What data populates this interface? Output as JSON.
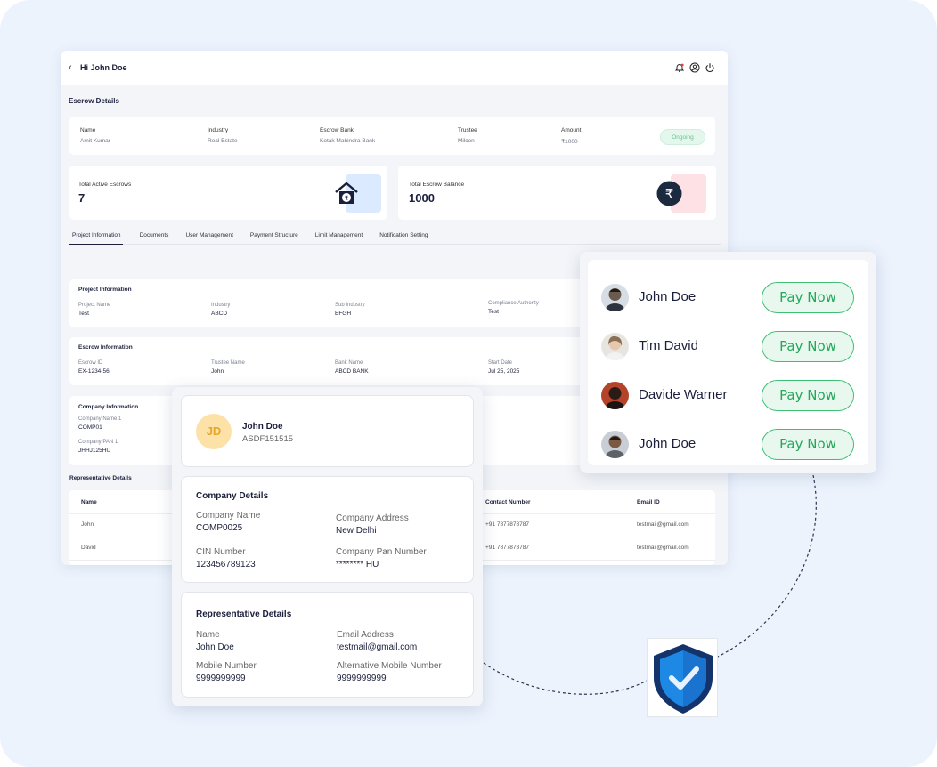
{
  "header": {
    "greeting": "Hi John Doe"
  },
  "escrow": {
    "title": "Escrow Details",
    "fields": [
      {
        "label": "Name",
        "value": "Amit Kumar"
      },
      {
        "label": "Industry",
        "value": "Real Estate"
      },
      {
        "label": "Escrow Bank",
        "value": "Kotak Mahindra Bank"
      },
      {
        "label": "Trustee",
        "value": "Milcon"
      },
      {
        "label": "Amount",
        "value": "₹1000"
      }
    ],
    "status": "Ongoing"
  },
  "stats": [
    {
      "label": "Total Active Escrows",
      "value": "7",
      "icon": "house-rupee-icon"
    },
    {
      "label": "Total Escrow Balance",
      "value": "1000",
      "icon": "rupee-icon"
    }
  ],
  "tabs": [
    "Project Information",
    "Documents",
    "User Management",
    "Payment Structure",
    "Limit Management",
    "Notification Setting"
  ],
  "project_info": {
    "title": "Project Information",
    "fields": [
      {
        "label": "Project Name",
        "value": "Test"
      },
      {
        "label": "Industry",
        "value": "ABCD"
      },
      {
        "label": "Sub Industry",
        "value": "EFGH"
      },
      {
        "label": "Compliance Authority",
        "value": "Test"
      }
    ]
  },
  "escrow_info": {
    "title": "Escrow Information",
    "fields": [
      {
        "label": "Escrow ID",
        "value": "EX-1234-56"
      },
      {
        "label": "Trustee Name",
        "value": "John"
      },
      {
        "label": "Bank Name",
        "value": "ABCD BANK"
      },
      {
        "label": "Start Date",
        "value": "Jul 25, 2025"
      }
    ]
  },
  "company_info": {
    "title": "Company Information",
    "fields": [
      {
        "label": "Company Name 1",
        "value": "COMP01"
      },
      {
        "label": "Company PAN 1",
        "value": "JHHJ125HU"
      }
    ]
  },
  "representatives": {
    "title": "Representative Details",
    "columns": [
      "Name",
      "Contact Number",
      "Email ID"
    ],
    "rows": [
      {
        "name": "John",
        "contact": "+91 7877878787",
        "email": "testmail@gmail.com"
      },
      {
        "name": "David",
        "contact": "+91 7877878787",
        "email": "testmail@gmail.com"
      }
    ]
  },
  "detail_popup": {
    "initials": "JD",
    "name": "John Doe",
    "id": "ASDF151515",
    "company": {
      "title": "Company Details",
      "fields": [
        {
          "label": "Company Name",
          "value": "COMP0025"
        },
        {
          "label": "Company Address",
          "value": "New Delhi"
        },
        {
          "label": "CIN Number",
          "value": "123456789123"
        },
        {
          "label": "Company Pan Number",
          "value": "******** HU"
        }
      ]
    },
    "representative": {
      "title": "Representative Details",
      "fields": [
        {
          "label": "Name",
          "value": "John Doe"
        },
        {
          "label": "Email Address",
          "value": "testmail@gmail.com"
        },
        {
          "label": "Mobile Number",
          "value": "9999999999"
        },
        {
          "label": "Alternative Mobile Number",
          "value": "9999999999"
        }
      ]
    }
  },
  "payees": [
    {
      "name": "John Doe",
      "action": "Pay Now",
      "avatar_color": "#6b5a4e"
    },
    {
      "name": "Tim David",
      "action": "Pay Now",
      "avatar_color": "#c9b7a6"
    },
    {
      "name": "Davide Warner",
      "action": "Pay Now",
      "avatar_color": "#b5432a"
    },
    {
      "name": "John Doe",
      "action": "Pay Now",
      "avatar_color": "#5d6168"
    }
  ],
  "colors": {
    "accent_green": "#3fbf74",
    "shield_blue": "#1877d8",
    "navy": "#1b1f3b"
  }
}
